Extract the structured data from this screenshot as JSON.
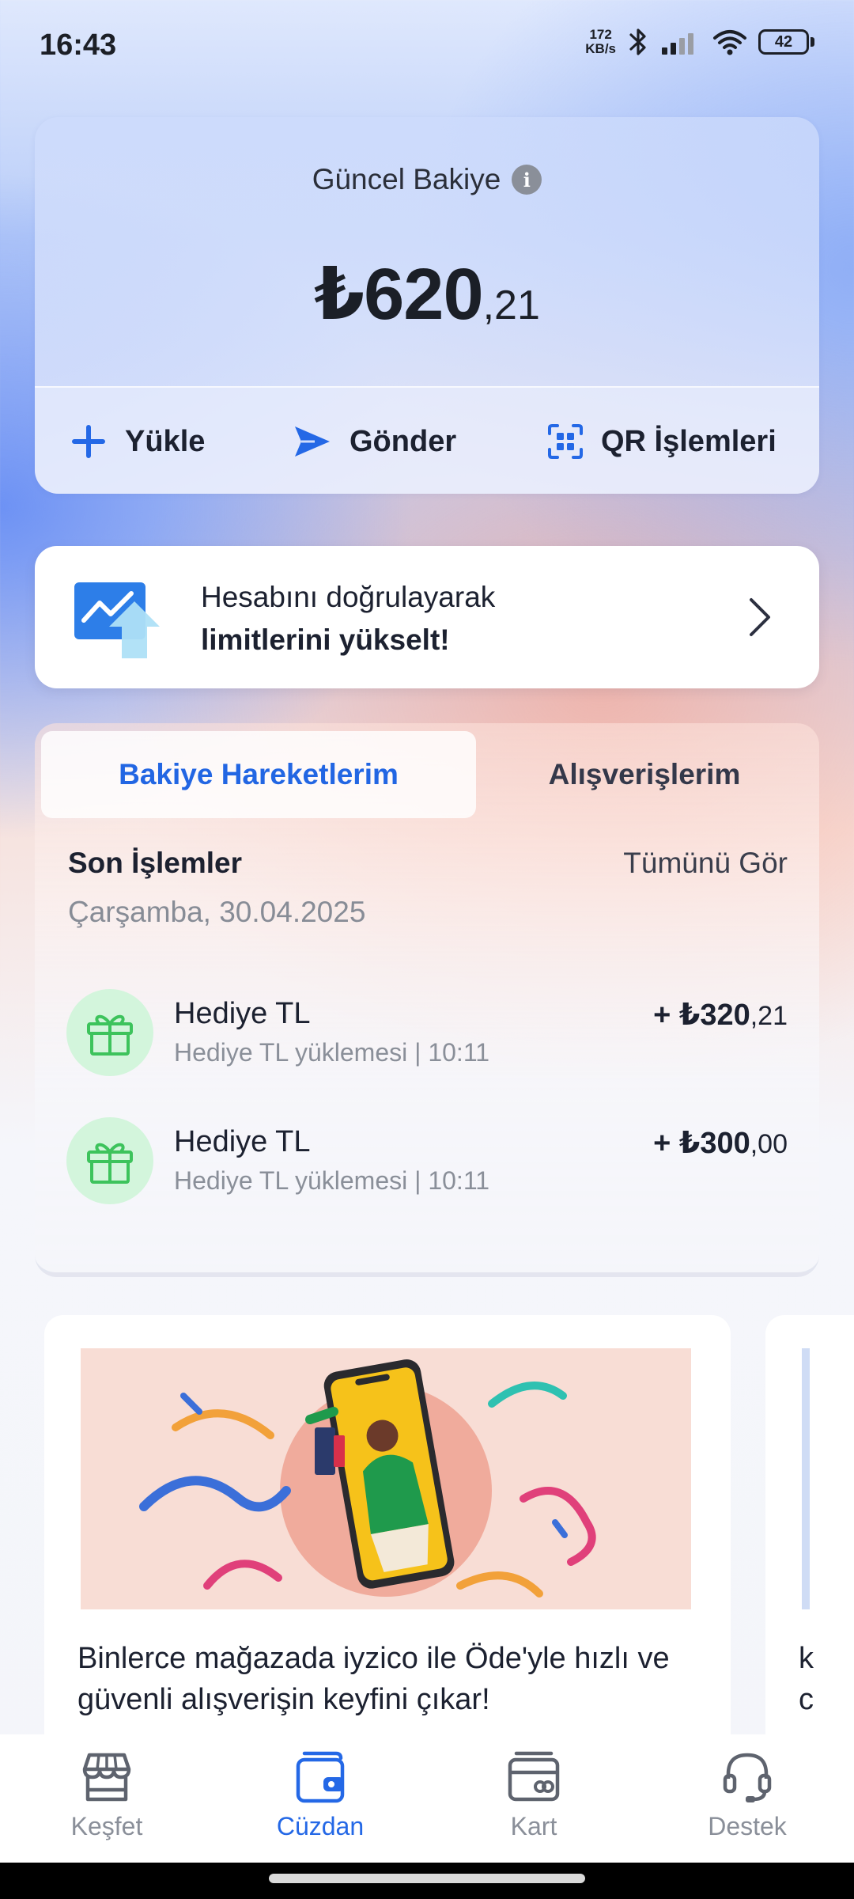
{
  "status_bar": {
    "time": "16:43",
    "net_speed_value": "172",
    "net_speed_unit": "KB/s",
    "battery": "42",
    "icons": [
      "bluetooth-icon",
      "signal-icon",
      "wifi-icon",
      "battery-icon"
    ]
  },
  "balance": {
    "title": "Güncel Bakiye",
    "amount_main": "₺620",
    "amount_cents": ",21",
    "actions": {
      "load_label": "Yükle",
      "send_label": "Gönder",
      "qr_label": "QR İşlemleri"
    }
  },
  "verify_banner": {
    "line1": "Hesabını doğrulayarak",
    "line2": "limitlerini yükselt!"
  },
  "tabs": {
    "active": "Bakiye Hareketlerim",
    "inactive": "Alışverişlerim"
  },
  "transactions": {
    "section_title": "Son İşlemler",
    "see_all": "Tümünü Gör",
    "date": "Çarşamba, 30.04.2025",
    "items": [
      {
        "name": "Hediye TL",
        "desc": "Hediye TL yüklemesi | 10:11",
        "amount_main": "+ ₺320",
        "amount_cents": ",21"
      },
      {
        "name": "Hediye TL",
        "desc": "Hediye TL yüklemesi | 10:11",
        "amount_main": "+ ₺300",
        "amount_cents": ",00"
      }
    ]
  },
  "promos": [
    {
      "text": "Binlerce mağazada iyzico ile Öde'yle hızlı ve güvenli alışverişin keyfini çıkar!"
    },
    {
      "text": "k\nc"
    }
  ],
  "bottom_nav": {
    "items": [
      {
        "label": "Keşfet",
        "icon": "store-icon"
      },
      {
        "label": "Cüzdan",
        "icon": "wallet-icon",
        "active": true
      },
      {
        "label": "Kart",
        "icon": "card-icon"
      },
      {
        "label": "Destek",
        "icon": "headset-icon"
      }
    ]
  },
  "colors": {
    "accent": "#2468E6",
    "gift_icon_bg": "#D3F5DC",
    "gift_icon": "#3DC35C",
    "muted_text": "#8A8F99"
  }
}
